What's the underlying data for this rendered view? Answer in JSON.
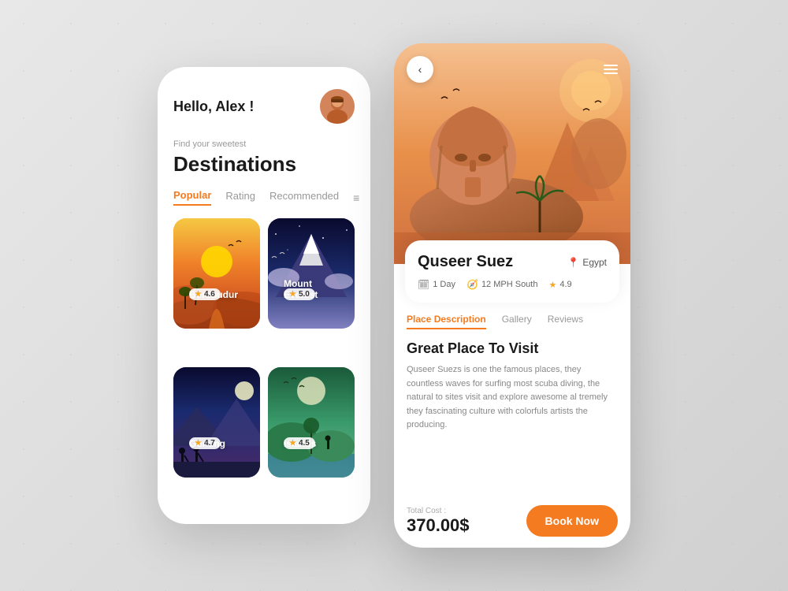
{
  "left_phone": {
    "greeting": "Hello, Alex !",
    "subtitle": "Find your sweetest",
    "main_title": "Destinations",
    "tabs": [
      {
        "label": "Popular",
        "active": true
      },
      {
        "label": "Rating",
        "active": false
      },
      {
        "label": "Recommended",
        "active": false
      }
    ],
    "cards": [
      {
        "name": "Borobudur",
        "rating": "4.6",
        "type": "borobudur"
      },
      {
        "name": "Mount Everest",
        "rating": "5.0",
        "type": "everest"
      },
      {
        "name": "Gunung",
        "rating": "4.7",
        "type": "gunung"
      },
      {
        "name": "Islands",
        "rating": "4.5",
        "type": "islands"
      }
    ]
  },
  "right_phone": {
    "back_label": "‹",
    "destination_name": "Quseer Suez",
    "location": "Egypt",
    "meta": [
      {
        "icon": "📅",
        "value": "1 Day"
      },
      {
        "icon": "🧭",
        "value": "12 MPH South"
      },
      {
        "icon": "⭐",
        "value": "4.9"
      }
    ],
    "content_tabs": [
      {
        "label": "Place Description",
        "active": true
      },
      {
        "label": "Gallery",
        "active": false
      },
      {
        "label": "Reviews",
        "active": false
      }
    ],
    "section_title": "Great Place To Visit",
    "description": "Quseer Suezs is one the famous places, they countless waves for surfing most scuba diving, the natural to sites visit and explore awesome al tremely they fascinating culture with colorfuls artists the  producing.",
    "price_label": "Total Cost :",
    "price": "370.00$",
    "book_label": "Book Now"
  }
}
